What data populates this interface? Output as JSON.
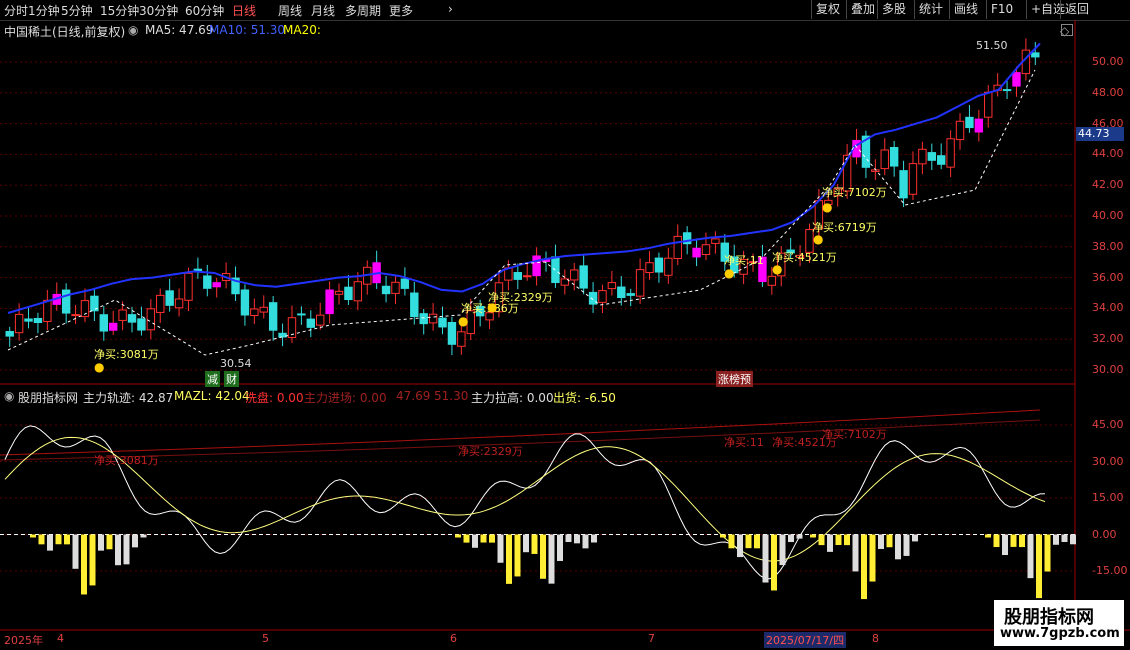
{
  "toolbar": {
    "tabs": [
      "分时",
      "1分钟",
      "5分钟",
      "15分钟",
      "30分钟",
      "60分钟",
      "日线",
      "周线",
      "月线",
      "多周期",
      "更多"
    ],
    "active_tab": "日线",
    "right": [
      "复权",
      "叠加",
      "多股",
      "统计",
      "画线",
      "F10",
      "+自选",
      "返回"
    ]
  },
  "main_header": {
    "title": "中国稀土(日线,前复权)",
    "ma5": "MA5: 47.69",
    "ma10": "MA10: 51.30",
    "ma20": "MA20:"
  },
  "price_axis": [
    "50.00",
    "48.00",
    "46.00",
    "44.00",
    "42.00",
    "40.00",
    "38.00",
    "36.00",
    "34.00",
    "32.00",
    "30.00"
  ],
  "current_price": "44.73",
  "high_marker": "51.50",
  "low_marker": "30.54",
  "annotations": [
    "净买:3081万",
    "净买:2329万",
    "净买:386万",
    "净买:11",
    "净买:4521万",
    "净买:6719万",
    "净买:7102万"
  ],
  "badges": [
    "减",
    "财",
    "涨榜预"
  ],
  "sub_header": {
    "title": "股朋指标网",
    "zhuli": "主力轨迹: 42.87",
    "mazl": "MAZL: 42.04",
    "xipan": "洗盘: 0.00",
    "jinchang": "主力进场: 0.00",
    "v1": "47.69",
    "v2": "51.30",
    "lagao": "主力拉高: 0.00",
    "chuhuo": "出货: -6.50"
  },
  "sub_axis": [
    "45.00",
    "30.00",
    "15.00",
    "0.00",
    "-15.00"
  ],
  "sub_annotations": [
    "净买:3081万",
    "净买:2329万",
    "净买:11",
    "净买:4521万",
    "净买:7102万"
  ],
  "date_axis": [
    "2025年",
    "4",
    "5",
    "6",
    "7",
    "2025/07/17/四",
    "8"
  ],
  "watermark": {
    "title": "股朋指标网",
    "url": "www.7gpzb.com"
  },
  "colors": {
    "up": "#ff00ff",
    "down": "#33dddd",
    "ma": "#2233ff",
    "grid": "#7a0000",
    "axis": "#e04040"
  },
  "chart_data": {
    "type": "candlestick",
    "ylim": [
      29,
      52
    ],
    "ma_line": [
      33.7,
      34.1,
      34.5,
      34.9,
      35.2,
      35.6,
      35.9,
      36.0,
      36.2,
      36.4,
      36.3,
      35.8,
      35.5,
      35.4,
      35.6,
      35.8,
      36.0,
      36.1,
      36.3,
      36.1,
      35.7,
      35.2,
      35.1,
      35.6,
      36.5,
      36.9,
      37.2,
      37.4,
      37.5,
      37.6,
      37.7,
      37.9,
      38.2,
      38.4,
      38.6,
      38.7,
      38.9,
      39.1,
      39.6,
      40.6,
      42.0,
      44.5,
      45.3,
      45.6,
      46.0,
      46.4,
      47.1,
      47.8,
      48.2,
      49.8,
      51.2
    ]
  }
}
